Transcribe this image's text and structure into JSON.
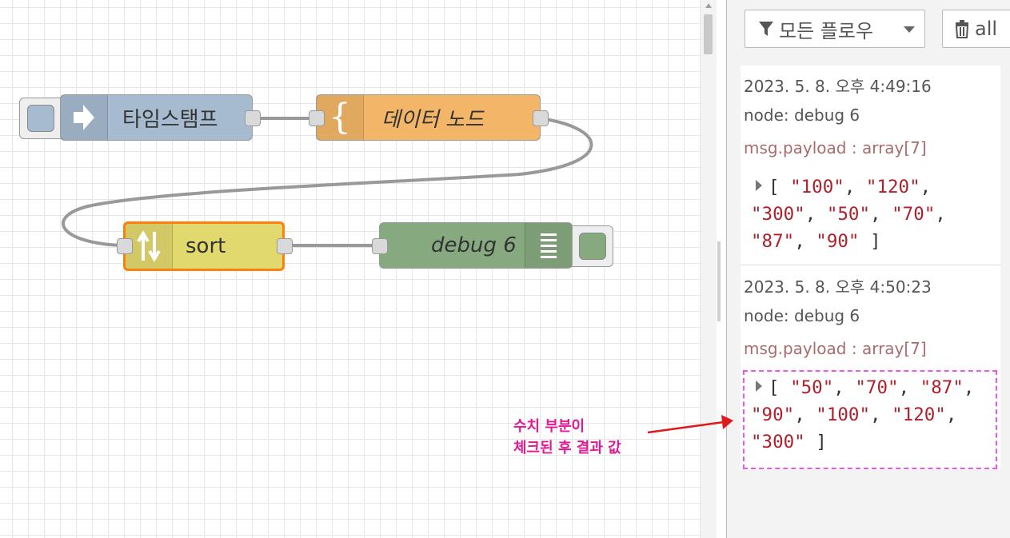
{
  "flow": {
    "nodes": [
      {
        "id": "inject",
        "label": "타임스탬프",
        "color": "#a6bbcf",
        "icon": "arrow-right-icon"
      },
      {
        "id": "template",
        "label": "데이터 노드",
        "color": "#f3b567",
        "icon": "curly-brace-icon"
      },
      {
        "id": "sort",
        "label": "sort",
        "color": "#e2d96e",
        "icon": "sort-arrows-icon"
      },
      {
        "id": "debug",
        "label": "debug 6",
        "color": "#87a980",
        "icon": "list-lines-icon"
      }
    ]
  },
  "sidebar": {
    "filter_label": "모든 플로우",
    "clear_label": "all",
    "messages": [
      {
        "timestamp": "2023. 5. 8. 오후 4:49:16",
        "node": "node: debug 6",
        "topic": "msg.payload : array[7]",
        "values": [
          "\"100\"",
          "\"120\"",
          "\"300\"",
          "\"50\"",
          "\"70\"",
          "\"87\"",
          "\"90\""
        ]
      },
      {
        "timestamp": "2023. 5. 8. 오후 4:50:23",
        "node": "node: debug 6",
        "topic": "msg.payload : array[7]",
        "values": [
          "\"50\"",
          "\"70\"",
          "\"87\"",
          "\"90\"",
          "\"100\"",
          "\"120\"",
          "\"300\""
        ]
      }
    ]
  },
  "annotation": {
    "line1": "수치 부분이",
    "line2": "체크된 후 결과 값"
  },
  "colors": {
    "selected_outline": "#ff7f0e",
    "annotation": "#e21a93",
    "arrow": "#e01a1a",
    "highlight_border": "#ee55ee"
  }
}
